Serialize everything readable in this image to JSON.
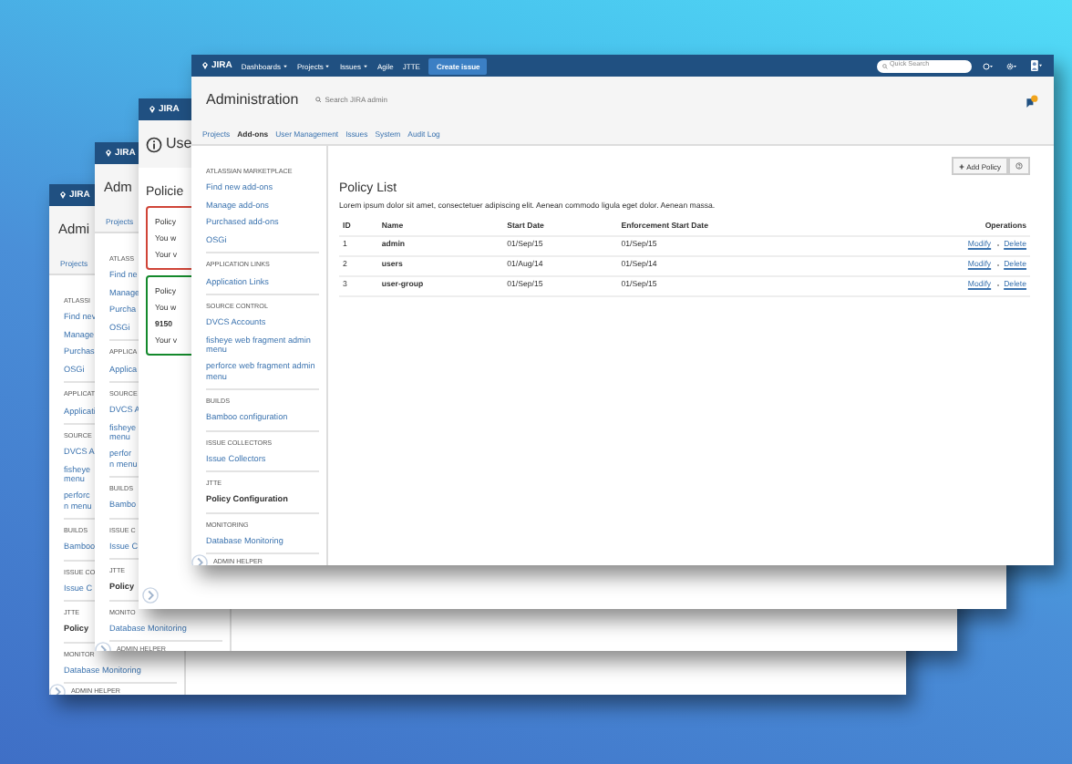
{
  "windows": [
    {
      "kind": "admin",
      "logo": "JIRA",
      "heading": "Admi",
      "tabs": [
        {
          "label": "Projects",
          "selected": false
        }
      ],
      "sidebar": [
        {
          "title": "ATLASSI",
          "items": [
            {
              "text": "Find nev",
              "selected": false
            },
            {
              "text": "Manage",
              "selected": false
            },
            {
              "text": "Purchas",
              "selected": false
            },
            {
              "text": "OSGi",
              "selected": false
            }
          ]
        },
        {
          "title": "APPLICAT",
          "items": [
            {
              "text": "Applicati",
              "selected": false
            }
          ]
        },
        {
          "title": "SOURCE",
          "items": [
            {
              "text": "DVCS A",
              "selected": false
            },
            {
              "text": "fisheye\nmenu",
              "selected": false
            },
            {
              "text": "perforc\nn menu",
              "selected": false
            }
          ]
        },
        {
          "title": "BUILDS",
          "items": [
            {
              "text": "Bamboo",
              "selected": false
            }
          ]
        },
        {
          "title": "ISSUE CO",
          "items": [
            {
              "text": "Issue C",
              "selected": false
            }
          ]
        },
        {
          "title": "JTTE",
          "items": [
            {
              "text": "Policy",
              "selected": true
            }
          ]
        },
        {
          "title": "MONITOR",
          "items": [
            {
              "text": "Database Monitoring",
              "selected": false
            }
          ]
        }
      ],
      "footer": "ADMIN HELPER"
    },
    {
      "kind": "admin",
      "logo": "JIRA",
      "heading": "Adm",
      "tabs": [
        {
          "label": "Projects",
          "selected": false
        }
      ],
      "sidebar": [
        {
          "title": "ATLASS",
          "items": [
            {
              "text": "Find ne",
              "selected": false
            },
            {
              "text": "Manage",
              "selected": false
            },
            {
              "text": "Purcha",
              "selected": false
            },
            {
              "text": "OSGi",
              "selected": false
            }
          ]
        },
        {
          "title": "APPLICA",
          "items": [
            {
              "text": "Applica",
              "selected": false
            }
          ]
        },
        {
          "title": "SOURCE",
          "items": [
            {
              "text": "DVCS A",
              "selected": false
            },
            {
              "text": "fisheye\nmenu",
              "selected": false
            },
            {
              "text": "perfor\nn menu",
              "selected": false
            }
          ]
        },
        {
          "title": "BUILDS",
          "items": [
            {
              "text": "Bambo",
              "selected": false
            }
          ]
        },
        {
          "title": "ISSUE C",
          "items": [
            {
              "text": "Issue C",
              "selected": false
            }
          ]
        },
        {
          "title": "JTTE",
          "items": [
            {
              "text": "Policy",
              "selected": true
            }
          ]
        },
        {
          "title": "MONITO",
          "items": [
            {
              "text": "Database Monitoring",
              "selected": false
            }
          ]
        }
      ],
      "footer": "ADMIN HELPER"
    },
    {
      "kind": "notice",
      "logo": "JIRA",
      "heading": "Use",
      "subheading": "Policie",
      "messages": [
        {
          "color": "#d04437",
          "lines": [
            {
              "kind": "text",
              "text": "Policy"
            },
            {
              "kind": "text",
              "text": "You w"
            },
            {
              "kind": "text",
              "text": "Your v"
            }
          ]
        },
        {
          "color": "#14892c",
          "lines": [
            {
              "kind": "text",
              "text": "Policy"
            },
            {
              "kind": "text",
              "text": "You w"
            },
            {
              "kind": "strong",
              "text": "9150"
            },
            {
              "kind": "text",
              "text": "Your v"
            }
          ]
        }
      ]
    },
    {
      "kind": "front",
      "logo": "JIRA",
      "nav": [
        {
          "label": "Dashboards",
          "dropdown": true
        },
        {
          "label": "Projects",
          "dropdown": true
        },
        {
          "label": "Issues",
          "dropdown": true
        },
        {
          "label": "Agile",
          "dropdown": false
        },
        {
          "label": "JTTE",
          "dropdown": false
        }
      ],
      "create_button": "Create issue",
      "quick_search": {
        "placeholder": "Quick Search"
      },
      "heading": "Administration",
      "admin_search": {
        "placeholder": "Search JIRA admin"
      },
      "tabs": [
        {
          "label": "Projects",
          "selected": false
        },
        {
          "label": "Add-ons",
          "selected": true
        },
        {
          "label": "User Management",
          "selected": false
        },
        {
          "label": "Issues",
          "selected": false
        },
        {
          "label": "System",
          "selected": false
        },
        {
          "label": "Audit Log",
          "selected": false
        }
      ],
      "sidebar": [
        {
          "title": "ATLASSIAN MARKETPLACE",
          "items": [
            {
              "text": "Find new add-ons",
              "selected": false
            },
            {
              "text": "Manage add-ons",
              "selected": false
            },
            {
              "text": "Purchased add-ons",
              "selected": false
            },
            {
              "text": "OSGi",
              "selected": false
            }
          ]
        },
        {
          "title": "APPLICATION LINKS",
          "items": [
            {
              "text": "Application Links",
              "selected": false
            }
          ]
        },
        {
          "title": "SOURCE CONTROL",
          "items": [
            {
              "text": "DVCS Accounts",
              "selected": false
            },
            {
              "text": "fisheye web fragment admin menu",
              "selected": false
            },
            {
              "text": "perforce web fragment admin menu",
              "selected": false
            }
          ]
        },
        {
          "title": "BUILDS",
          "items": [
            {
              "text": "Bamboo configuration",
              "selected": false
            }
          ]
        },
        {
          "title": "ISSUE COLLECTORS",
          "items": [
            {
              "text": "Issue Collectors",
              "selected": false
            }
          ]
        },
        {
          "title": "JTTE",
          "items": [
            {
              "text": "Policy Configuration",
              "selected": true
            }
          ]
        },
        {
          "title": "MONITORING",
          "items": [
            {
              "text": "Database Monitoring",
              "selected": false
            }
          ]
        }
      ],
      "footer": "ADMIN HELPER",
      "add_button": "Add Policy",
      "title": "Policy List",
      "description": "Lorem ipsum dolor sit amet, consectetuer adipiscing elit. Aenean commodo ligula eget dolor. Aenean massa.",
      "table": {
        "columns": [
          "ID",
          "Name",
          "Start Date",
          "Enforcement Start Date",
          "Operations"
        ],
        "rows": [
          {
            "id": "1",
            "name": "admin",
            "start": "01/Sep/15",
            "enforcement": "01/Sep/15",
            "actions": [
              "Modify",
              "Delete"
            ]
          },
          {
            "id": "2",
            "name": "users",
            "start": "01/Aug/14",
            "enforcement": "01/Sep/14",
            "actions": [
              "Modify",
              "Delete"
            ]
          },
          {
            "id": "3",
            "name": "user-group",
            "start": "01/Sep/15",
            "enforcement": "01/Sep/15",
            "actions": [
              "Modify",
              "Delete"
            ]
          }
        ]
      }
    }
  ]
}
